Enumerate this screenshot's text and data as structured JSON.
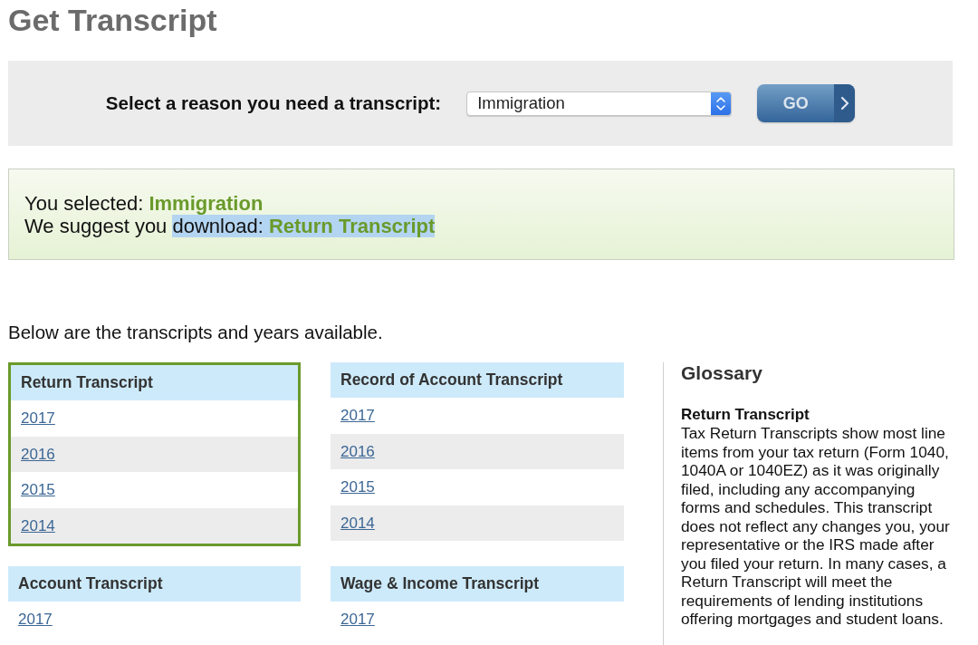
{
  "page_title": "Get Transcript",
  "reason_bar": {
    "label": "Select a reason you need a transcript:",
    "select": {
      "value": "Immigration"
    },
    "go_button": {
      "label": "GO"
    }
  },
  "suggestion": {
    "lines": [
      {
        "parts": [
          {
            "text": "You selected:",
            "emphasis": false,
            "highlighted": false
          },
          {
            "text": "Immigration",
            "emphasis": true,
            "highlighted": false
          }
        ]
      },
      {
        "parts": [
          {
            "text": "We suggest you",
            "emphasis": false,
            "highlighted": false
          },
          {
            "text": "download:",
            "emphasis": false,
            "highlighted": true
          },
          {
            "text": "Return Transcript",
            "emphasis": true,
            "highlighted": true
          }
        ]
      }
    ]
  },
  "intro": "Below are the transcripts and years available.",
  "transcripts": [
    {
      "title": "Return Transcript",
      "selected": true,
      "years": [
        "2017",
        "2016",
        "2015",
        "2014"
      ]
    },
    {
      "title": "Record of Account Transcript",
      "selected": false,
      "years": [
        "2017",
        "2016",
        "2015",
        "2014"
      ]
    },
    {
      "title": "Account Transcript",
      "selected": false,
      "years": [
        "2017"
      ]
    },
    {
      "title": "Wage & Income Transcript",
      "selected": false,
      "years": [
        "2017"
      ]
    }
  ],
  "glossary": {
    "title": "Glossary",
    "entries": [
      {
        "term": "Return Transcript",
        "definition": "Tax Return Transcripts show most line items from your tax return (Form 1040, 1040A or 1040EZ) as it was originally filed, including any accompanying forms and schedules. This transcript does not reflect any changes you, your representative or the IRS made after you filed your return. In many cases, a Return Transcript will meet the requirements of lending institutions offering mortgages and student loans."
      }
    ]
  }
}
